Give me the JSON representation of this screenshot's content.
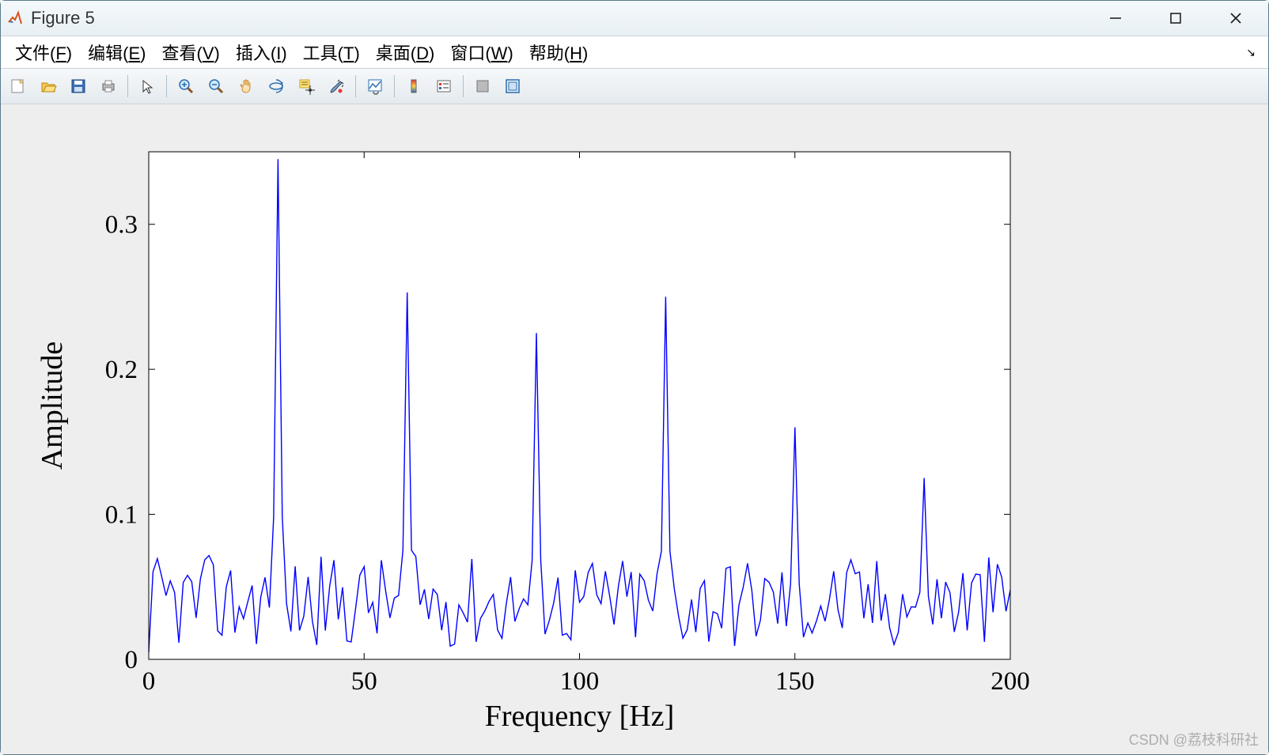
{
  "window": {
    "title": "Figure 5",
    "min_icon": "—",
    "max_icon": "☐",
    "close_icon": "✕"
  },
  "menubar": {
    "file": {
      "label": "文件",
      "mn": "F"
    },
    "edit": {
      "label": "编辑",
      "mn": "E"
    },
    "view": {
      "label": "查看",
      "mn": "V"
    },
    "insert": {
      "label": "插入",
      "mn": "I"
    },
    "tools": {
      "label": "工具",
      "mn": "T"
    },
    "desktop": {
      "label": "桌面",
      "mn": "D"
    },
    "window": {
      "label": "窗口",
      "mn": "W"
    },
    "help": {
      "label": "帮助",
      "mn": "H"
    },
    "collapse": "❯"
  },
  "toolbar": {
    "items": [
      {
        "name": "new-figure-icon"
      },
      {
        "name": "open-icon"
      },
      {
        "name": "save-icon"
      },
      {
        "name": "print-icon"
      },
      {
        "sep": true
      },
      {
        "name": "pointer-icon"
      },
      {
        "sep": true
      },
      {
        "name": "zoom-in-icon"
      },
      {
        "name": "zoom-out-icon"
      },
      {
        "name": "pan-icon"
      },
      {
        "name": "rotate3d-icon"
      },
      {
        "name": "data-cursor-icon"
      },
      {
        "name": "brush-icon"
      },
      {
        "sep": true
      },
      {
        "name": "link-plot-icon"
      },
      {
        "sep": true
      },
      {
        "name": "colorbar-icon"
      },
      {
        "name": "legend-icon"
      },
      {
        "sep": true
      },
      {
        "name": "hide-tools-icon"
      },
      {
        "name": "dock-icon"
      }
    ]
  },
  "watermark": "CSDN @荔枝科研社",
  "chart_data": {
    "type": "line",
    "xlabel": "Frequency [Hz]",
    "ylabel": "Amplitude",
    "xlim": [
      0,
      200
    ],
    "ylim": [
      0,
      0.35
    ],
    "xticks": [
      0,
      50,
      100,
      150,
      200
    ],
    "yticks": [
      0,
      0.1,
      0.2,
      0.3
    ],
    "x_step": 1,
    "peaks": [
      {
        "f": 30,
        "a": 0.345
      },
      {
        "f": 60,
        "a": 0.253
      },
      {
        "f": 90,
        "a": 0.225
      },
      {
        "f": 120,
        "a": 0.25
      },
      {
        "f": 150,
        "a": 0.16
      },
      {
        "f": 180,
        "a": 0.125
      }
    ],
    "noise_mean": 0.04,
    "noise_spread": 0.032,
    "peak_half_width": 2,
    "series_color": "#0000ff"
  }
}
